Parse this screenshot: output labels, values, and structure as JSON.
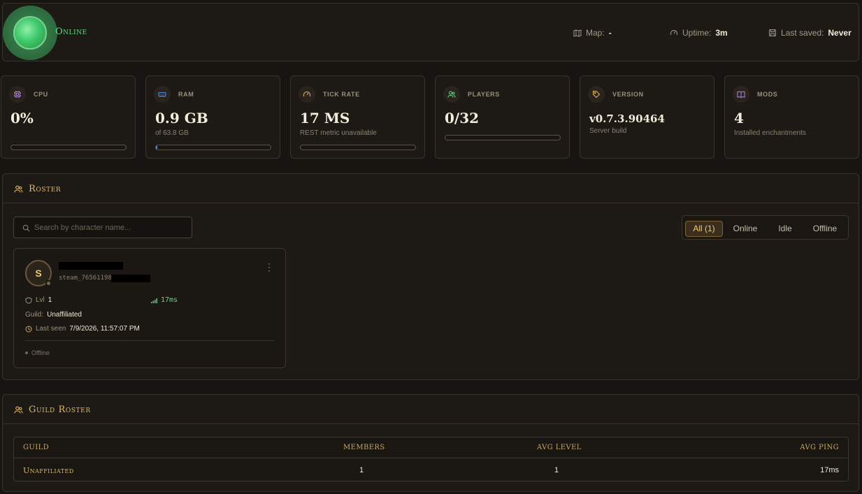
{
  "header": {
    "status": "Online",
    "map_label": "Map:",
    "map_value": "-",
    "uptime_label": "Uptime:",
    "uptime_value": "3m",
    "saved_label": "Last saved:",
    "saved_value": "Never"
  },
  "cards": {
    "cpu": {
      "label": "CPU",
      "value": "0%",
      "progress": 0
    },
    "ram": {
      "label": "RAM",
      "value": "0.9 GB",
      "sub": "of 63.8 GB",
      "progress": 0.014
    },
    "tick": {
      "label": "TICK RATE",
      "value": "17 MS",
      "sub": "REST metric unavailable",
      "progress": 0
    },
    "players": {
      "label": "PLAYERS",
      "value": "0/32",
      "progress": 0
    },
    "version": {
      "label": "VERSION",
      "value": "v0.7.3.90464",
      "sub": "Server build"
    },
    "mods": {
      "label": "MODS",
      "value": "4",
      "sub": "Installed enchantments"
    }
  },
  "roster": {
    "title": "Roster",
    "search_placeholder": "Search by character name...",
    "filters": [
      "All (1)",
      "Online",
      "Idle",
      "Offline"
    ],
    "player": {
      "initial": "S",
      "steam": "steam_76561198",
      "level_label": "Lvl",
      "level": "1",
      "ping": "17ms",
      "guild_label": "Guild:",
      "guild": "Unaffiliated",
      "last_seen_label": "Last seen",
      "last_seen": "7/9/2026, 11:57:07 PM",
      "status": "Offline"
    }
  },
  "guild": {
    "title": "Guild Roster",
    "columns": [
      "GUILD",
      "MEMBERS",
      "AVG LEVEL",
      "AVG PING"
    ],
    "rows": [
      {
        "guild": "Unaffiliated",
        "members": "1",
        "avg_level": "1",
        "avg_ping": "17ms"
      }
    ]
  },
  "colors": {
    "accent": "#e0b860",
    "online": "#5fd97f",
    "background": "#171512"
  }
}
